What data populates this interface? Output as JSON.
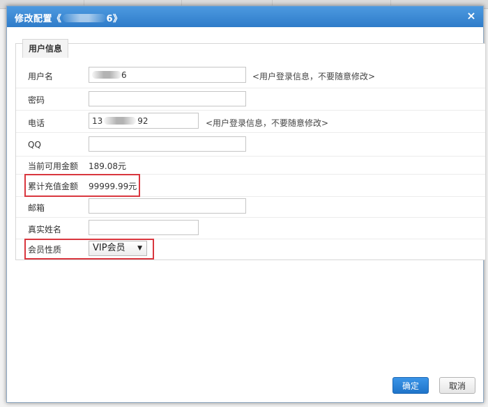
{
  "dialog": {
    "title_prefix": "修改配置《",
    "title_suffix": "6》",
    "close_glyph": "×"
  },
  "panel": {
    "legend": "用户信息"
  },
  "form": {
    "username": {
      "label": "用户名",
      "value_suffix": "6",
      "hint": "<用户登录信息，不要随意修改>"
    },
    "password": {
      "label": "密码",
      "value": ""
    },
    "phone": {
      "label": "电话",
      "value_prefix": "13",
      "value_suffix": "92",
      "hint": "<用户登录信息，不要随意修改>"
    },
    "qq": {
      "label": "QQ",
      "value": ""
    },
    "balance": {
      "label": "当前可用金额",
      "value": "189.08元"
    },
    "total_recharge": {
      "label": "累计充值金额",
      "value": "99999.99元"
    },
    "email": {
      "label": "邮箱",
      "value": ""
    },
    "real_name": {
      "label": "真实姓名",
      "value": ""
    },
    "member_type": {
      "label": "会员性质",
      "selected": "VIP会员",
      "caret": "▼"
    }
  },
  "buttons": {
    "ok": "确定",
    "cancel": "取消"
  },
  "colors": {
    "titlebar": "#2f7cc9",
    "highlight": "#d9363e",
    "ok_button": "#1f74c9"
  }
}
